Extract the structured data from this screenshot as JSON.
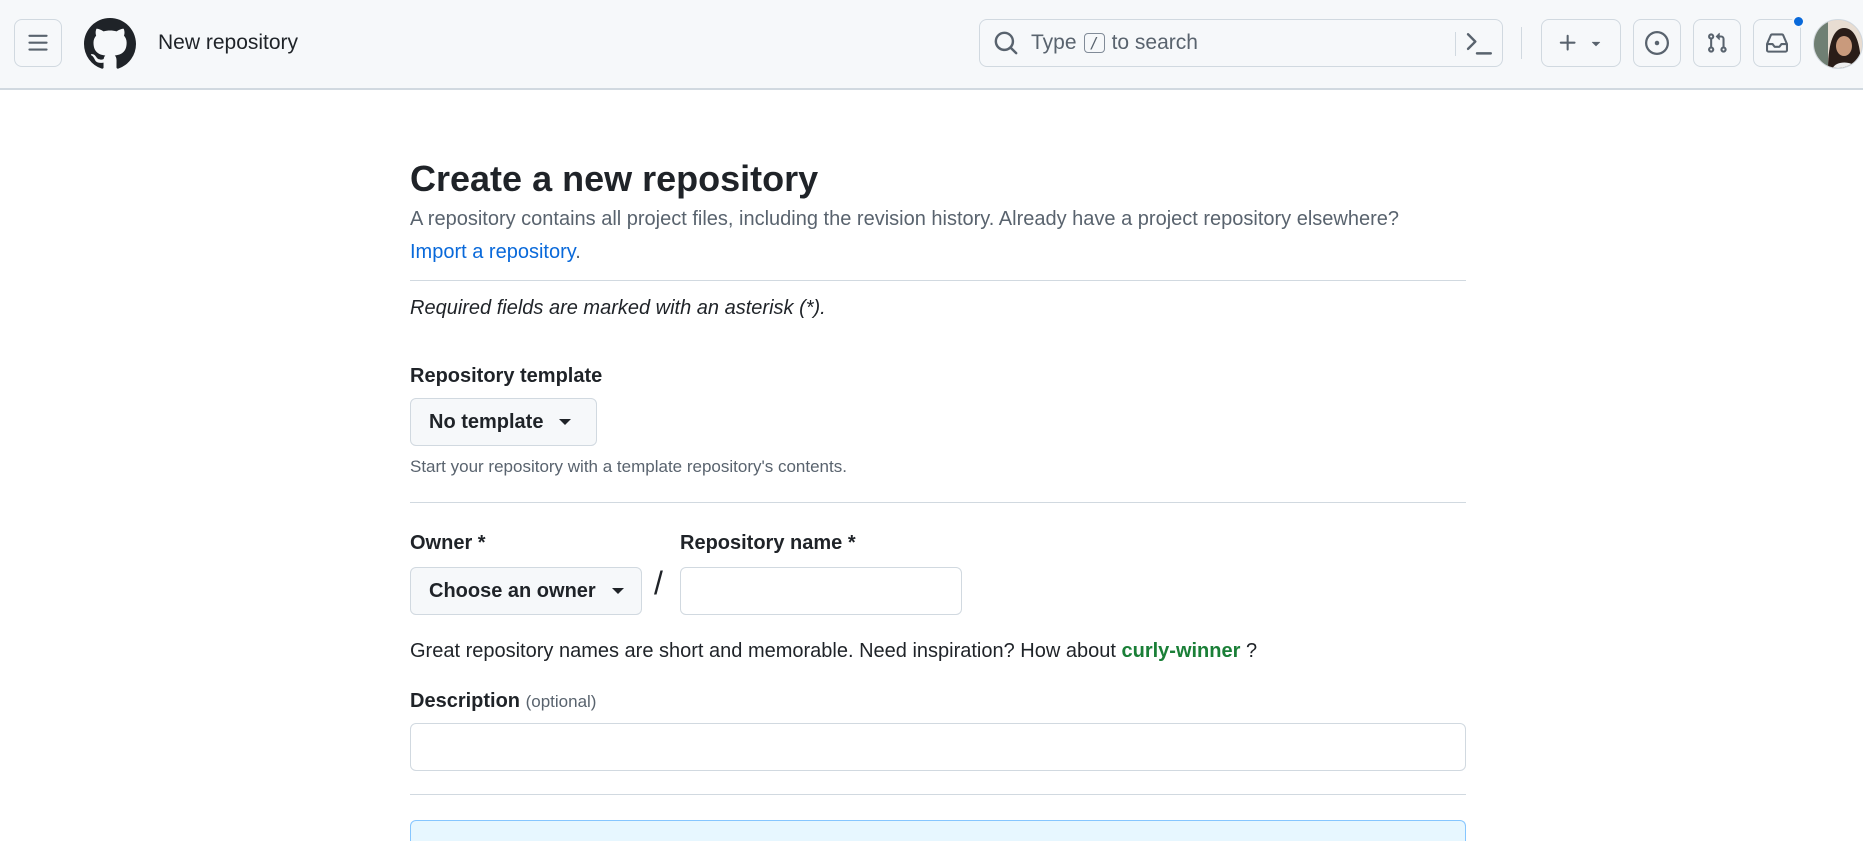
{
  "header": {
    "context_title": "New repository",
    "search": {
      "prefix": "Type",
      "kbd": "/",
      "suffix": "to search"
    }
  },
  "main": {
    "title": "Create a new repository",
    "lead": "A repository contains all project files, including the revision history. Already have a project repository elsewhere?",
    "import_link": "Import a repository",
    "import_link_suffix": ".",
    "required_note": "Required fields are marked with an asterisk (*).",
    "template": {
      "label": "Repository template",
      "selected": "No template",
      "hint": "Start your repository with a template repository's contents."
    },
    "owner": {
      "label": "Owner *",
      "selected": "Choose an owner"
    },
    "separator": "/",
    "repo_name": {
      "label": "Repository name *",
      "value": ""
    },
    "inspiration": {
      "text": "Great repository names are short and memorable. Need inspiration? How about",
      "suggestion": "curly-winner",
      "suffix": "?"
    },
    "description": {
      "label": "Description",
      "optional": "(optional)",
      "value": ""
    }
  },
  "colors": {
    "accent": "#0969da",
    "success": "#1a7f37",
    "header_bg": "#f6f8fa",
    "border": "#d1d9e0",
    "muted_text": "#59636e"
  },
  "icons": [
    "hamburger-icon",
    "github-logo-icon",
    "search-icon",
    "command-palette-icon",
    "plus-icon",
    "chevron-down-icon",
    "issues-icon",
    "pull-request-icon",
    "inbox-icon"
  ]
}
